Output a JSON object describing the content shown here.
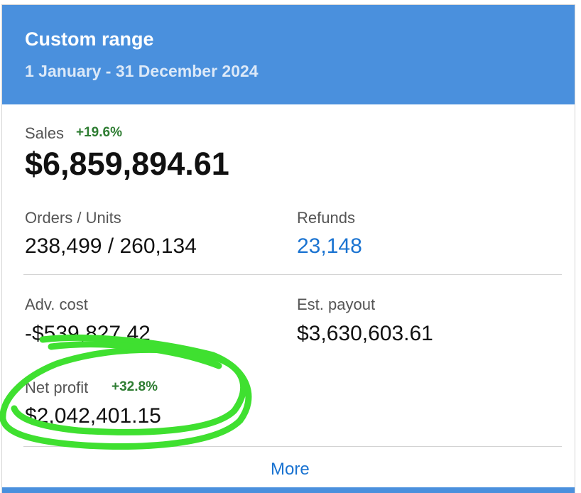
{
  "header": {
    "title": "Custom range",
    "date_range": "1 January - 31 December 2024",
    "color": "#4a90dd"
  },
  "sales": {
    "label": "Sales",
    "change": "+19.6%",
    "value": "$6,859,894.61"
  },
  "orders_units": {
    "label": "Orders / Units",
    "value": "238,499 / 260,134"
  },
  "refunds": {
    "label": "Refunds",
    "value": "23,148"
  },
  "adv_cost": {
    "label": "Adv. cost",
    "value": "-$539,827.42"
  },
  "est_payout": {
    "label": "Est. payout",
    "value": "$3,630,603.61"
  },
  "net_profit": {
    "label": "Net profit",
    "change": "+32.8%",
    "value": "$2,042,401.15"
  },
  "more_link": "More",
  "colors": {
    "positive_change": "#2e7d32",
    "link": "#1a73d1",
    "highlight_circle": "#3fe030"
  }
}
